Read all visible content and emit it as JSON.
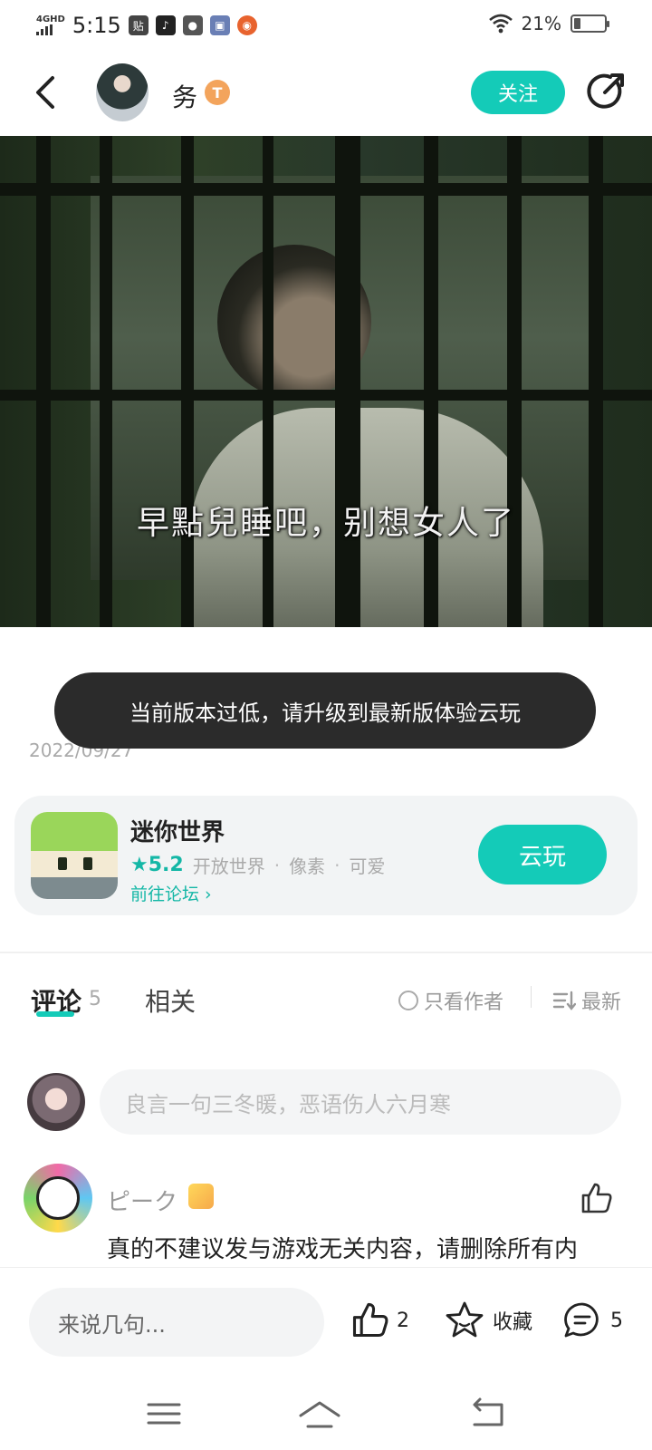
{
  "status_bar": {
    "network": "4GHD",
    "time": "5:15",
    "battery_text": "21%",
    "battery_level": 0.21,
    "app_icons": [
      "tieba-icon",
      "douyin-icon",
      "wechat-icon",
      "game-icon",
      "pumpkin-icon"
    ]
  },
  "header": {
    "author_name": "务",
    "level_badge": "T",
    "follow_label": "关注"
  },
  "media": {
    "subtitle": "早點兒睡吧，别想女人了"
  },
  "post": {
    "date": "2022/09/27"
  },
  "toast": {
    "message": "当前版本过低，请升级到最新版体验云玩"
  },
  "game": {
    "name": "迷你世界",
    "rating": "★5.2",
    "tags": [
      "开放世界",
      "像素",
      "可爱"
    ],
    "tag_sep": "·",
    "forum_link": "前往论坛 ›",
    "cloud_play": "云玩"
  },
  "tabs": {
    "comments": "评论",
    "comments_count": "5",
    "related": "相关",
    "only_author": "只看作者",
    "sort": "最新"
  },
  "comment_input": {
    "placeholder": "良言一句三冬暖，恶语伤人六月寒"
  },
  "comments": [
    {
      "username": "ピーク",
      "text": "真的不建议发与游戏无关内容，请删除所有内"
    }
  ],
  "bottom_bar": {
    "say_placeholder": "来说几句...",
    "like_count": "2",
    "favorite_label": "收藏",
    "comment_count": "5"
  },
  "colors": {
    "accent": "#14cbb8",
    "toast_bg": "#2b2b2b",
    "card_bg": "#f2f4f5"
  }
}
